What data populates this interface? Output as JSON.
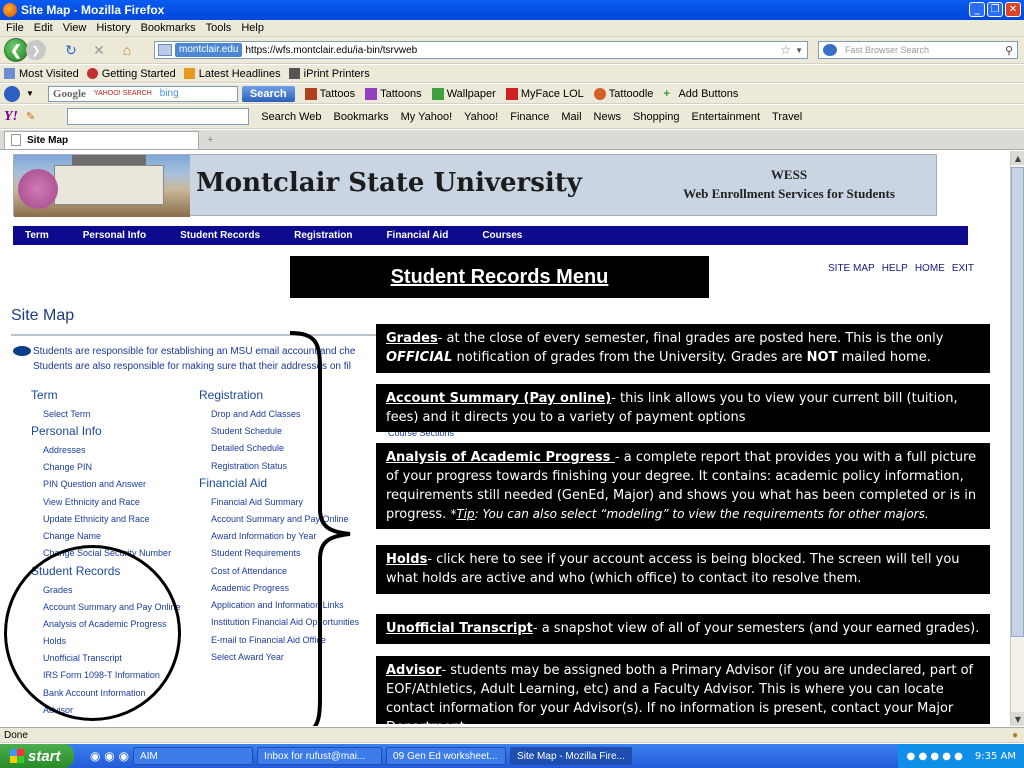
{
  "window": {
    "title": "Site Map - Mozilla Firefox",
    "buttons": [
      "_",
      "❐",
      "✕"
    ]
  },
  "menu": [
    "File",
    "Edit",
    "View",
    "History",
    "Bookmarks",
    "Tools",
    "Help"
  ],
  "nav": {
    "domain": "montclair.edu",
    "url": "https://wfs.montclair.edu/ia-bin/tsrvweb",
    "search_placeholder": "Fast Browser Search"
  },
  "bookmarks": [
    "Most Visited",
    "Getting Started",
    "Latest Headlines",
    "iPrint Printers"
  ],
  "googlebar": {
    "logo": "Google",
    "yahoo": "YAHOO! SEARCH",
    "bing": "bing",
    "search_label": "Search",
    "items": [
      "Tattoos",
      "Tattoons",
      "Wallpaper",
      "MyFace LOL",
      "Tattoodle",
      "Add Buttons"
    ]
  },
  "yahoobar": {
    "logo": "Y!",
    "items": [
      "Search Web",
      "Bookmarks",
      "My Yahoo!",
      "Yahoo!",
      "Finance",
      "Mail",
      "News",
      "Shopping",
      "Entertainment",
      "Travel"
    ]
  },
  "tab": {
    "label": "Site Map",
    "plus": "+"
  },
  "page": {
    "university": "Montclair State University",
    "wess_line1": "WESS",
    "wess_line2": "Web Enrollment Services for Students",
    "navstrip": [
      "Term",
      "Personal Info",
      "Student Records",
      "Registration",
      "Financial Aid",
      "Courses"
    ],
    "toplinks": [
      "SITE MAP",
      "HELP",
      "HOME",
      "EXIT"
    ],
    "menu_title": "Student Records Menu",
    "sitemap_title": "Site Map",
    "note_line1": "Students are responsible for establishing an MSU email account and che",
    "note_line2": "Students are also responsible for making sure that their addresses on fil",
    "col1": {
      "term": "Term",
      "term_links": [
        "Select Term"
      ],
      "personal": "Personal Info",
      "personal_links": [
        "Addresses",
        "Change PIN",
        "PIN Question and Answer",
        "View Ethnicity and Race",
        "Update Ethnicity and Race",
        "Change Name",
        "Change Social Security Number"
      ],
      "records": "Student Records",
      "records_links": [
        "Grades",
        "Account Summary and Pay Online",
        "Analysis of Academic Progress",
        "Holds",
        "Unofficial Transcript",
        "IRS Form 1098-T Information",
        "Bank Account Information",
        "Advisor"
      ]
    },
    "col2": {
      "registration": "Registration",
      "registration_links": [
        "Drop and Add Classes",
        "Student Schedule",
        "Detailed Schedule",
        "Registration Status"
      ],
      "finaid": "Financial Aid",
      "finaid_links": [
        "Financial Aid Summary",
        "Account Summary and Pay Online",
        "Award Information by Year",
        "Student Requirements",
        "Cost of Attendance",
        "Academic Progress",
        "Application and Information Links",
        "Institution Financial Aid Opportunities",
        "E-mail to Financial Aid Office",
        "Select Award Year"
      ],
      "hidden_link": "Course Sections"
    }
  },
  "callouts": {
    "grades": {
      "head": "Grades",
      "t1": "-  at the close of every semester,  final grades are posted here. This is the only ",
      "em": "OFFICIAL",
      "t2": " notification of grades from the University. Grades are ",
      "not": "NOT",
      "t3": " mailed home."
    },
    "account": {
      "head": "Account Summary (Pay online)",
      "text": "-  this link allows you to view your current bill (tuition, fees) and it directs you to a variety of payment options"
    },
    "analysis": {
      "head": "Analysis of Academic Progress ",
      "text": "-  a complete report that provides you  with a full picture of your progress towards finishing your degree. It contains: academic policy information, requirements still needed (GenEd, Major) and shows you what has been completed or is in progress. ",
      "tip_star": "*",
      "tip_word": "Tip",
      "tip_rest": ": You can also select “modeling” to view the requirements for other majors."
    },
    "holds": {
      "head": "Holds",
      "text": "-  click here to see if your account access is being blocked. The screen will tell you what holds are active and who (which office) to contact ito resolve them."
    },
    "transcript": {
      "head": "Unofficial Transcript",
      "text": "-  a snapshot view of all of your semesters (and your earned grades)."
    },
    "advisor": {
      "head": "Advisor",
      "text": "-  students may be assigned both a Primary Advisor (if you are undeclared, part of EOF/Athletics, Adult Learning, etc) and a Faculty Advisor. This is where you can locate contact information for your Advisor(s). If no information is present, contact your Major Department."
    }
  },
  "status": "Done",
  "taskbar": {
    "start": "start",
    "tasks": [
      "AIM",
      "Inbox for rufust@mai...",
      "09 Gen Ed worksheet...",
      "Site Map - Mozilla Fire..."
    ],
    "time": "9:35 AM"
  }
}
